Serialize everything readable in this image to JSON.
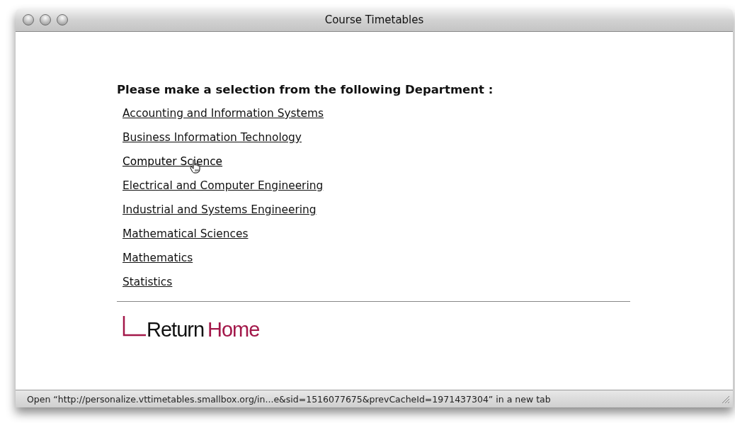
{
  "window": {
    "title": "Course Timetables"
  },
  "heading": "Please make a selection from the following Department :",
  "departments": [
    {
      "label": "Accounting and Information Systems",
      "hovered": false
    },
    {
      "label": "Business Information Technology",
      "hovered": false
    },
    {
      "label": "Computer Science",
      "hovered": true
    },
    {
      "label": "Electrical and Computer Engineering",
      "hovered": false
    },
    {
      "label": "Industrial and Systems Engineering",
      "hovered": false
    },
    {
      "label": "Mathematical Sciences",
      "hovered": false
    },
    {
      "label": "Mathematics",
      "hovered": false
    },
    {
      "label": "Statistics",
      "hovered": false
    }
  ],
  "return_link": {
    "first_word": "Return",
    "second_word": "Home"
  },
  "status_bar": "Open “http://personalize.vttimetables.smallbox.org/in...e&sid=1516077675&prevCacheId=1971437304” in a new tab"
}
